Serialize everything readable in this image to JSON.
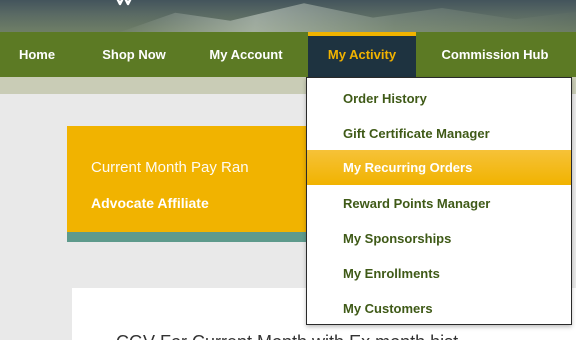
{
  "nav": {
    "items": [
      {
        "label": "Home"
      },
      {
        "label": "Shop Now"
      },
      {
        "label": "My Account"
      },
      {
        "label": "My Activity",
        "active": true
      },
      {
        "label": "Commission Hub"
      }
    ]
  },
  "dropdown": {
    "items": [
      {
        "label": "Order History"
      },
      {
        "label": "Gift Certificate Manager"
      },
      {
        "label": "My Recurring Orders",
        "highlighted": true
      },
      {
        "label": "Reward Points Manager"
      },
      {
        "label": "My Sponsorships"
      },
      {
        "label": "My Enrollments"
      },
      {
        "label": "My Customers"
      }
    ]
  },
  "pay_rank": {
    "label": "Current Month Pay Ran",
    "value": "Advocate Affiliate"
  },
  "cgv": {
    "title": "CGV For Current Month with Ex month hist"
  },
  "icons": {
    "logo": "star-logo-icon"
  },
  "colors": {
    "nav_bg": "#5c7a24",
    "nav_active_bg": "#1e3340",
    "accent": "#f1b300",
    "menu_text": "#3f5a17",
    "card_stripe": "#5e9a8c"
  }
}
